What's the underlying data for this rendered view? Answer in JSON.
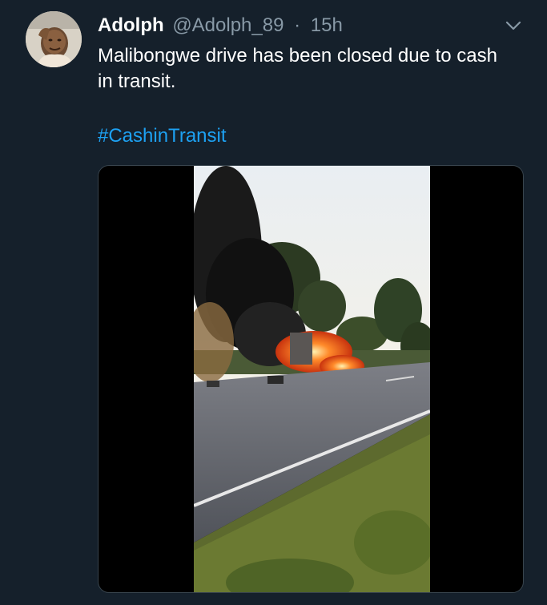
{
  "tweet": {
    "author_name": "Adolph",
    "author_handle": "@Adolph_89",
    "separator": "·",
    "timestamp": "15h",
    "text": "Malibongwe drive has been closed due to cash in transit.",
    "hashtag": "#CashinTransit"
  },
  "icons": {
    "more": "chevron-down-icon",
    "avatar": "avatar-photo"
  },
  "colors": {
    "background": "#15202b",
    "name": "#ffffff",
    "secondary_text": "#8899a6",
    "link": "#1da1f2",
    "media_border": "#38444d"
  }
}
